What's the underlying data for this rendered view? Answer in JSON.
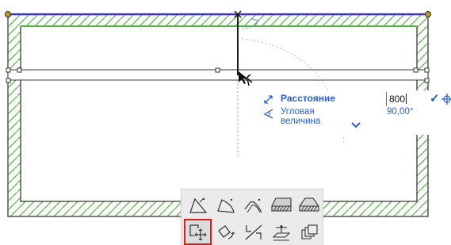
{
  "tracker": {
    "distance_label": "Расстояние",
    "distance_value": "800",
    "angle_label": "Угловая величина",
    "angle_value": "90,00°",
    "confirm_glyph": "✓",
    "move_icon": "crosshair-move-icon",
    "expand_icon": "chevron-down-icon"
  },
  "pet_palette": {
    "row1": [
      "offset-icon",
      "curved-edge-icon",
      "fillet-icon",
      "slab-edge-icon",
      "slab-thickness-icon"
    ],
    "row2": [
      "drag-icon",
      "rotate-icon",
      "mirror-icon",
      "elevate-icon",
      "multiply-icon"
    ],
    "active": "drag-icon"
  },
  "colors": {
    "wall_hatch": "#58b34a",
    "wall_outline": "#2a2a2a",
    "selected_edge": "#3b2fc9",
    "accent_blue": "#2a62c9",
    "active_button_border": "#e01b1b",
    "palette_bg": "#ebebeb"
  }
}
